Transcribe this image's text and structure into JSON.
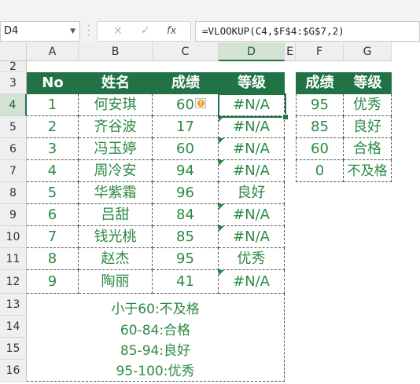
{
  "formula_bar": {
    "name_box": "D4",
    "cancel_icon": "×",
    "confirm_icon": "✓",
    "fx_icon": "fx",
    "formula": "=VLOOKUP(C4,$F$4:$G$7,2)"
  },
  "columns": [
    "A",
    "B",
    "C",
    "D",
    "E",
    "F",
    "G"
  ],
  "rows": [
    "2",
    "3",
    "4",
    "5",
    "6",
    "7",
    "8",
    "9",
    "10",
    "11",
    "12",
    "13",
    "14",
    "15",
    "16"
  ],
  "table": {
    "headers": [
      "No",
      "姓名",
      "成绩",
      "等级"
    ],
    "rows": [
      {
        "no": "1",
        "name": "何安琪",
        "score": "60",
        "grade": "#N/A"
      },
      {
        "no": "2",
        "name": "齐谷波",
        "score": "17",
        "grade": "#N/A"
      },
      {
        "no": "3",
        "name": "冯玉婷",
        "score": "60",
        "grade": "#N/A"
      },
      {
        "no": "4",
        "name": "周冷安",
        "score": "94",
        "grade": "#N/A"
      },
      {
        "no": "5",
        "name": "华紫霜",
        "score": "96",
        "grade": "良好"
      },
      {
        "no": "6",
        "name": "吕甜",
        "score": "84",
        "grade": "#N/A"
      },
      {
        "no": "7",
        "name": "钱光桃",
        "score": "85",
        "grade": "#N/A"
      },
      {
        "no": "8",
        "name": "赵杰",
        "score": "95",
        "grade": "优秀"
      },
      {
        "no": "9",
        "name": "陶丽",
        "score": "41",
        "grade": "#N/A"
      }
    ]
  },
  "lookup": {
    "headers": [
      "成绩",
      "等级"
    ],
    "rows": [
      {
        "score": "95",
        "grade": "优秀"
      },
      {
        "score": "85",
        "grade": "良好"
      },
      {
        "score": "60",
        "grade": "合格"
      },
      {
        "score": "0",
        "grade": "不及格"
      }
    ]
  },
  "notes": [
    "小于60:不及格",
    "60-84:合格",
    "85-94:良好",
    "95-100:优秀"
  ],
  "colors": {
    "header_green": "#217346",
    "text_green": "#2c8a46"
  }
}
